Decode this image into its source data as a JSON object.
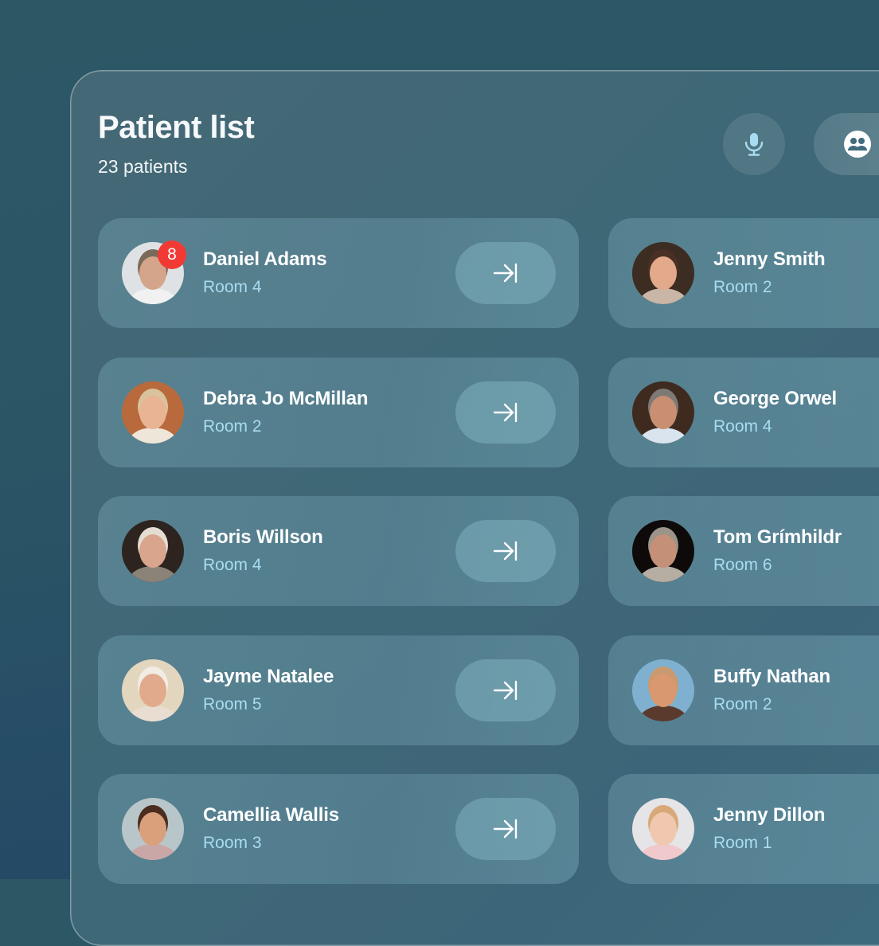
{
  "header": {
    "title": "Patient list",
    "subtitle": "23 patients",
    "mic_button_icon": "microphone-icon",
    "group_button_icon": "people-group-icon"
  },
  "colors": {
    "badge": "#f23a35",
    "room_text": "#a8dcf0",
    "name_text": "#ffffff",
    "icon_accent": "#a8dcf0"
  },
  "patients_left": [
    {
      "name": "Daniel Adams",
      "room": "Room 4",
      "badge": "8",
      "skin": "#d4a58a",
      "hair": "#7a6a5a",
      "bg": "#dfe2e4",
      "shirt": "#f1f1f1"
    },
    {
      "name": "Debra Jo McMillan",
      "room": "Room 2",
      "skin": "#e8b494",
      "hair": "#d9c39c",
      "bg": "#b86a3c",
      "shirt": "#efe6da"
    },
    {
      "name": "Boris Willson",
      "room": "Room 4",
      "skin": "#d9a58c",
      "hair": "#e4ddd3",
      "bg": "#2d2420",
      "shirt": "#8b8378"
    },
    {
      "name": "Jayme Natalee",
      "room": "Room 5",
      "skin": "#e2aa8c",
      "hair": "#f1ede5",
      "bg": "#e3d6be",
      "shirt": "#e9ddd2"
    },
    {
      "name": "Camellia Wallis",
      "room": "Room 3",
      "skin": "#d9a07c",
      "hair": "#4a2d1f",
      "bg": "#b9c6c9",
      "shirt": "#c9a7a7"
    }
  ],
  "patients_right": [
    {
      "name": "Jenny Smith",
      "room": "Room 2",
      "skin": "#e2a98a",
      "hair": "#4a3024",
      "bg": "#3c2c22",
      "shirt": "#c9b6a6"
    },
    {
      "name": "George Orwel",
      "room": "Room 4",
      "skin": "#c98f72",
      "hair": "#7d7a76",
      "bg": "#3f2a20",
      "shirt": "#d9e4ee"
    },
    {
      "name": "Tom Grímhildr",
      "room": "Room 6",
      "skin": "#c49078",
      "hair": "#9c948a",
      "bg": "#0d0a09",
      "shirt": "#b6aea2"
    },
    {
      "name": "Buffy Nathan",
      "room": "Room 2",
      "skin": "#d9986e",
      "hair": "#c99a70",
      "bg": "#7fb0cf",
      "shirt": "#5a3a2c"
    },
    {
      "name": "Jenny Dillon",
      "room": "Room 1",
      "skin": "#f0c8b0",
      "hair": "#d8a878",
      "bg": "#e5e4e6",
      "shirt": "#f0c9cc"
    }
  ],
  "row_action_icon": "arrow-right-to-bar-icon"
}
